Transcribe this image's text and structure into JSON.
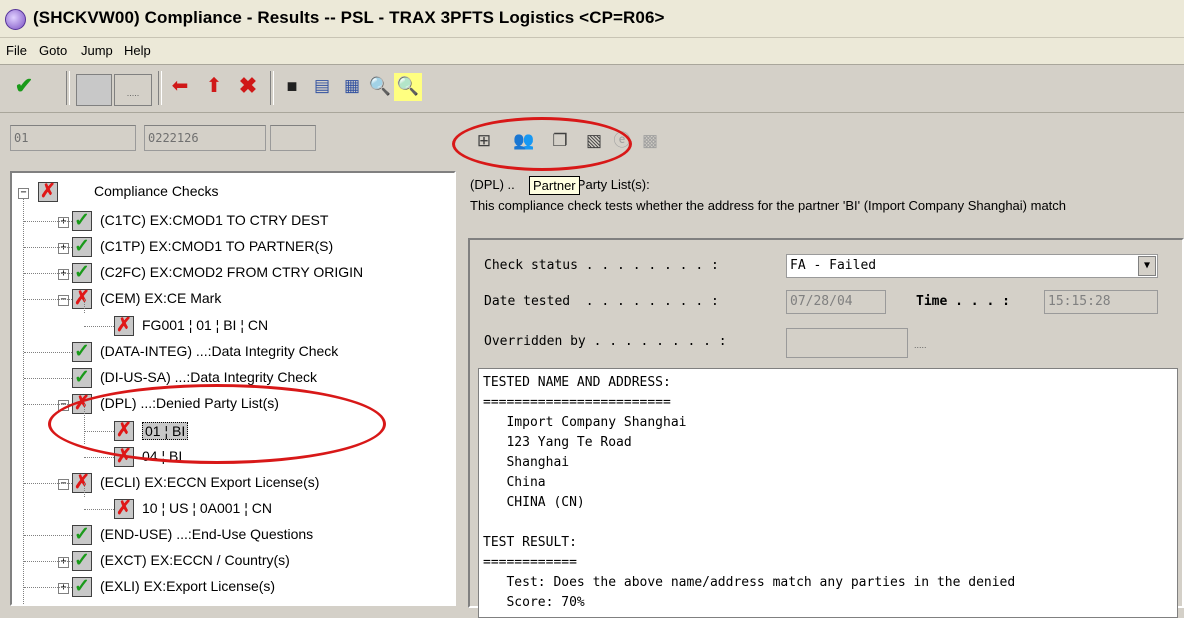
{
  "window": {
    "title": "(SHCKVW00) Compliance - Results  -- PSL - TRAX 3PFTS Logistics <CP=R06>"
  },
  "menu": [
    "File",
    "Goto",
    "Jump",
    "Help"
  ],
  "keys": {
    "field1": "01",
    "field2": "0222126",
    "field3": "",
    "ellipsis": "....."
  },
  "tooltip": "Partner",
  "tree": {
    "root": "Compliance Checks",
    "items": [
      {
        "label": "(C1TC) EX:CMOD1 TO CTRY DEST",
        "status": "pass"
      },
      {
        "label": "(C1TP) EX:CMOD1 TO PARTNER(S)",
        "status": "pass"
      },
      {
        "label": "(C2FC) EX:CMOD2 FROM CTRY ORIGIN",
        "status": "pass"
      },
      {
        "label": "(CEM) EX:CE Mark",
        "status": "fail"
      },
      {
        "label": "FG001 ¦ 01 ¦ BI ¦ CN",
        "status": "fail"
      },
      {
        "label": "(DATA-INTEG) ...:Data Integrity Check",
        "status": "pass"
      },
      {
        "label": "(DI-US-SA) ...:Data Integrity Check",
        "status": "pass"
      },
      {
        "label": "(DPL) ...:Denied Party List(s)",
        "status": "fail"
      },
      {
        "label": "01 ¦ BI",
        "status": "fail"
      },
      {
        "label": "04 ¦ BI",
        "status": "fail"
      },
      {
        "label": "(ECLI) EX:ECCN Export License(s)",
        "status": "fail"
      },
      {
        "label": "10 ¦ US ¦ 0A001 ¦ CN",
        "status": "fail"
      },
      {
        "label": "(END-USE) ...:End-Use Questions",
        "status": "pass"
      },
      {
        "label": "(EXCT) EX:ECCN / Country(s)",
        "status": "pass"
      },
      {
        "label": "(EXLI) EX:Export License(s)",
        "status": "pass"
      }
    ]
  },
  "detail": {
    "header_prefix": "(DPL) ..",
    "header_suffix": "Party List(s):",
    "description": "This compliance check tests whether the address for the partner 'BI' (Import Company Shanghai) match",
    "check_status_label": "Check status . . . . . . . . :",
    "check_status_value": "FA - Failed",
    "date_label": "Date tested  . . . . . . . . :",
    "date_value": "07/28/04",
    "time_label": "Time . . . :",
    "time_value": "15:15:28",
    "overridden_label": "Overridden by . . . . . . . . :",
    "overridden_value": "",
    "overridden_ellipsis": ".....",
    "text_lines": [
      "TESTED NAME AND ADDRESS:",
      "========================",
      "   Import Company Shanghai",
      "   123 Yang Te Road",
      "   Shanghai",
      "   China",
      "   CHINA (CN)",
      "",
      "TEST RESULT:",
      "============",
      "   Test: Does the above name/address match any parties in the denied",
      "   Score: 70%"
    ]
  }
}
